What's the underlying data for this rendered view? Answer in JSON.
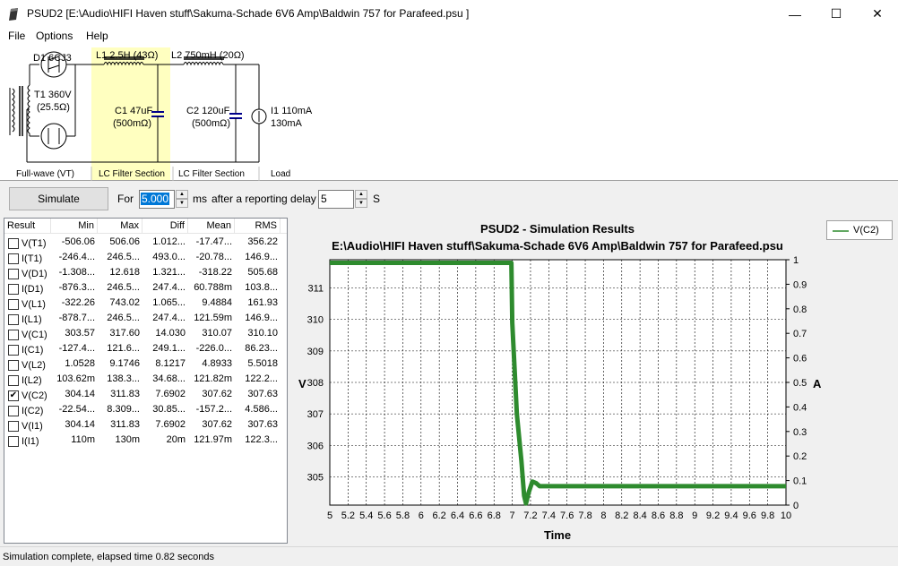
{
  "window": {
    "title": "PSUD2  [E:\\Audio\\HIFI Haven stuff\\Sakuma-Schade 6V6 Amp\\Baldwin 757 for Parafeed.psu ]",
    "minimize": "—",
    "maximize": "☐",
    "close": "✕"
  },
  "menu": {
    "file": "File",
    "options": "Options",
    "help": "Help"
  },
  "circuit": {
    "d1": "D1 6CJ3",
    "t1_line1": "T1 360V",
    "t1_line2": "(25.5Ω)",
    "l1": "L1 2.5H (43Ω)",
    "l2": "L2 750mH (20Ω)",
    "c1_line1": "C1 47uF",
    "c1_line2": "(500mΩ)",
    "c2_line1": "C2 120uF",
    "c2_line2": "(500mΩ)",
    "i1_line1": "I1 110mA",
    "i1_line2": "130mA",
    "section_fullwave": "Full-wave (VT)",
    "section_lc1": "LC Filter Section",
    "section_lc2": "LC Filter Section",
    "section_load": "Load"
  },
  "toolbar": {
    "simulate": "Simulate",
    "for_label": "For",
    "for_value": "5.000",
    "ms_label": "ms",
    "delay_label": "after a reporting delay of",
    "delay_value": "5",
    "s_label": "S"
  },
  "table": {
    "headers": [
      "Result",
      "Min",
      "Max",
      "Diff",
      "Mean",
      "RMS"
    ],
    "rows": [
      {
        "name": "V(T1)",
        "checked": false,
        "min": "-506.06",
        "max": "506.06",
        "diff": "1.012...",
        "mean": "-17.47...",
        "rms": "356.22"
      },
      {
        "name": "I(T1)",
        "checked": false,
        "min": "-246.4...",
        "max": "246.5...",
        "diff": "493.0...",
        "mean": "-20.78...",
        "rms": "146.9..."
      },
      {
        "name": "V(D1)",
        "checked": false,
        "min": "-1.308...",
        "max": "12.618",
        "diff": "1.321...",
        "mean": "-318.22",
        "rms": "505.68"
      },
      {
        "name": "I(D1)",
        "checked": false,
        "min": "-876.3...",
        "max": "246.5...",
        "diff": "247.4...",
        "mean": "60.788m",
        "rms": "103.8..."
      },
      {
        "name": "V(L1)",
        "checked": false,
        "min": "-322.26",
        "max": "743.02",
        "diff": "1.065...",
        "mean": "9.4884",
        "rms": "161.93"
      },
      {
        "name": "I(L1)",
        "checked": false,
        "min": "-878.7...",
        "max": "246.5...",
        "diff": "247.4...",
        "mean": "121.59m",
        "rms": "146.9..."
      },
      {
        "name": "V(C1)",
        "checked": false,
        "min": "303.57",
        "max": "317.60",
        "diff": "14.030",
        "mean": "310.07",
        "rms": "310.10"
      },
      {
        "name": "I(C1)",
        "checked": false,
        "min": "-127.4...",
        "max": "121.6...",
        "diff": "249.1...",
        "mean": "-226.0...",
        "rms": "86.23..."
      },
      {
        "name": "V(L2)",
        "checked": false,
        "min": "1.0528",
        "max": "9.1746",
        "diff": "8.1217",
        "mean": "4.8933",
        "rms": "5.5018"
      },
      {
        "name": "I(L2)",
        "checked": false,
        "min": "103.62m",
        "max": "138.3...",
        "diff": "34.68...",
        "mean": "121.82m",
        "rms": "122.2..."
      },
      {
        "name": "V(C2)",
        "checked": true,
        "min": "304.14",
        "max": "311.83",
        "diff": "7.6902",
        "mean": "307.62",
        "rms": "307.63"
      },
      {
        "name": "I(C2)",
        "checked": false,
        "min": "-22.54...",
        "max": "8.309...",
        "diff": "30.85...",
        "mean": "-157.2...",
        "rms": "4.586..."
      },
      {
        "name": "V(I1)",
        "checked": false,
        "min": "304.14",
        "max": "311.83",
        "diff": "7.6902",
        "mean": "307.62",
        "rms": "307.63"
      },
      {
        "name": "I(I1)",
        "checked": false,
        "min": "110m",
        "max": "130m",
        "diff": "20m",
        "mean": "121.97m",
        "rms": "122.3..."
      }
    ]
  },
  "legend": {
    "label": "V(C2)",
    "color": "#2e8b2e"
  },
  "status": "Simulation complete, elapsed time 0.82 seconds",
  "chart_data": {
    "type": "line",
    "title": "PSUD2 - Simulation Results",
    "subtitle": "E:\\Audio\\HIFI Haven stuff\\Sakuma-Schade 6V6 Amp\\Baldwin 757 for Parafeed.psu",
    "xlabel": "Time",
    "ylabel": "V",
    "y2label": "A",
    "xlim": [
      5,
      10
    ],
    "ylim": [
      304.1,
      311.9
    ],
    "y2lim": [
      0,
      1
    ],
    "xticks": [
      "5",
      "5.2",
      "5.4",
      "5.6",
      "5.8",
      "6",
      "6.2",
      "6.4",
      "6.6",
      "6.8",
      "7",
      "7.2",
      "7.4",
      "7.6",
      "7.8",
      "8",
      "8.2",
      "8.4",
      "8.6",
      "8.8",
      "9",
      "9.2",
      "9.4",
      "9.6",
      "9.8",
      "10"
    ],
    "yticks": [
      "305",
      "306",
      "307",
      "308",
      "309",
      "310",
      "311"
    ],
    "y2ticks": [
      "0",
      "0.1",
      "0.2",
      "0.3",
      "0.4",
      "0.5",
      "0.6",
      "0.7",
      "0.8",
      "0.9",
      "1"
    ],
    "grid": true,
    "legend": "right",
    "series": [
      {
        "name": "V(C2)",
        "x": [
          5,
          6,
          6.99,
          7.0,
          7.05,
          7.1,
          7.13,
          7.15,
          7.18,
          7.22,
          7.26,
          7.3,
          7.4,
          8,
          9,
          10
        ],
        "y": [
          311.8,
          311.8,
          311.8,
          309.9,
          307.0,
          305.5,
          304.4,
          304.15,
          304.5,
          304.85,
          304.8,
          304.7,
          304.7,
          304.7,
          304.7,
          304.7
        ]
      }
    ]
  }
}
